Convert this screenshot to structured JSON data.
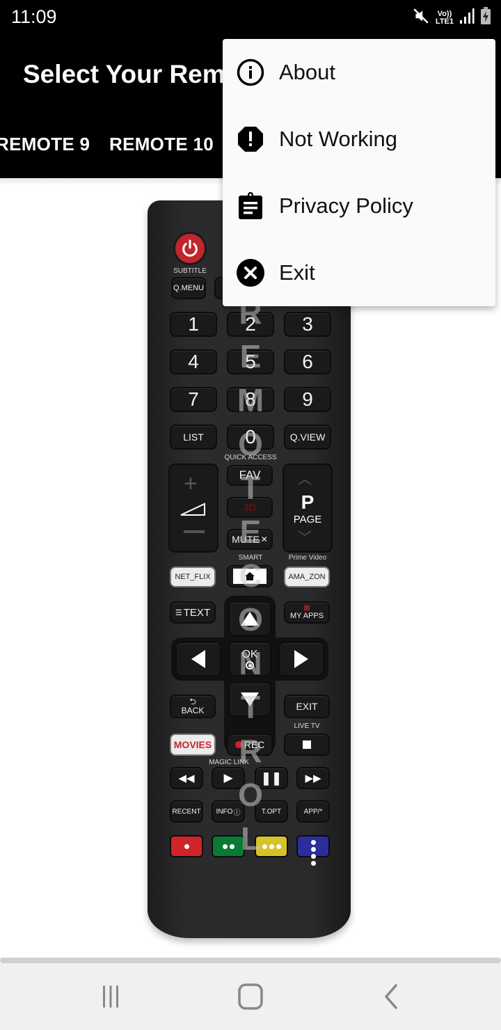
{
  "status_bar": {
    "time": "11:09",
    "volte_top": "Vo))",
    "volte_bottom": "LTE1",
    "icons": [
      "mute-icon",
      "volte-icon",
      "signal-icon",
      "battery-charging-icon"
    ]
  },
  "app_bar": {
    "title": "Select Your Remote",
    "tabs": [
      {
        "label": "REMOTE 9"
      },
      {
        "label": "REMOTE 10"
      }
    ]
  },
  "overflow_menu": {
    "items": [
      {
        "label": "About",
        "icon": "info-icon"
      },
      {
        "label": "Not Working",
        "icon": "alert-octagon-icon"
      },
      {
        "label": "Privacy Policy",
        "icon": "clipboard-icon"
      },
      {
        "label": "Exit",
        "icon": "cancel-icon"
      }
    ]
  },
  "remote": {
    "watermark": "REMOTECONTROL",
    "labels": {
      "subtitle": "SUBTITLE",
      "quick_access": "QUICK ACCESS",
      "smart": "SMART",
      "prime_video": "Prime Video",
      "live_tv": "LIVE TV",
      "magic_link": "MAGIC LINK"
    },
    "buttons": {
      "qmenu": "Q.MENU",
      "digits": [
        "1",
        "2",
        "3",
        "4",
        "5",
        "6",
        "7",
        "8",
        "9"
      ],
      "list": "LIST",
      "zero": "0",
      "qview": "Q.VIEW",
      "fav": "FAV",
      "three_d": "3D",
      "mute": "MUTE",
      "page_p": "P",
      "page": "PAGE",
      "netflix": "NET_FLIX",
      "amazon": "AMA_ZON",
      "text": "TEXT",
      "myapps": "MY APPS",
      "ok": "OK",
      "back": "BACK",
      "exit": "EXIT",
      "movies": "MOVIES",
      "rec": "REC",
      "recent": "RECENT",
      "info": "INFO",
      "topt": "T.OPT",
      "app": "APP/*"
    },
    "colors": {
      "power": "#c0272d",
      "red": "#d0232a",
      "green": "#0a7a34",
      "yellow": "#d6c229",
      "blue": "#2b2d9c"
    }
  },
  "nav_bar": {
    "buttons": [
      "recents-icon",
      "home-icon",
      "back-icon"
    ]
  }
}
